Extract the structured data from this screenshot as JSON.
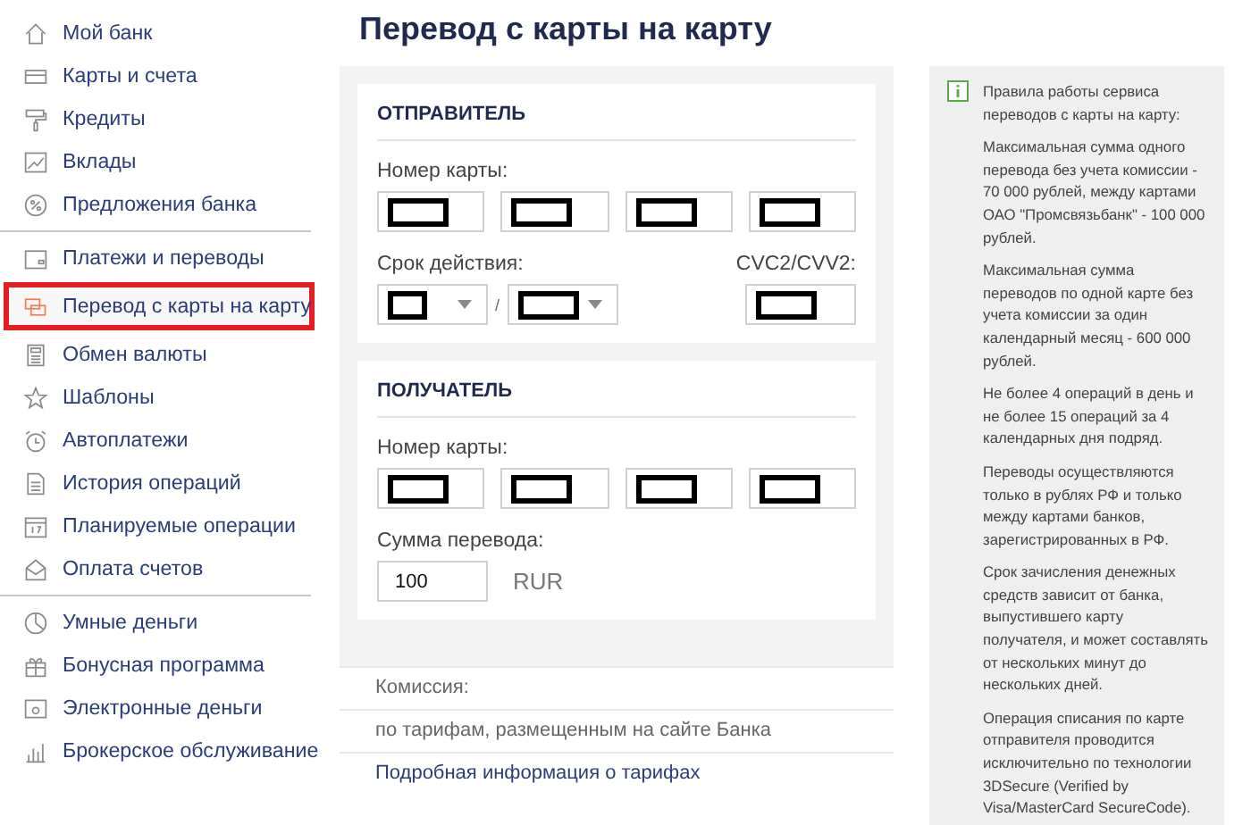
{
  "sidebar": {
    "groups": [
      {
        "items": [
          {
            "label": "Мой банк",
            "selected": false
          },
          {
            "label": "Карты и счета",
            "selected": false
          },
          {
            "label": "Кредиты",
            "selected": false
          },
          {
            "label": "Вклады",
            "selected": false
          },
          {
            "label": "Предложения банка",
            "selected": false
          }
        ]
      },
      {
        "items": [
          {
            "label": "Платежи и переводы",
            "selected": false
          },
          {
            "label": "Перевод с карты на карту",
            "selected": true
          },
          {
            "label": "Обмен валюты",
            "selected": false
          },
          {
            "label": "Шаблоны",
            "selected": false
          },
          {
            "label": "Автоплатежи",
            "selected": false
          },
          {
            "label": "История операций",
            "selected": false
          },
          {
            "label": "Планируемые операции",
            "selected": false
          },
          {
            "label": "Оплата счетов",
            "selected": false
          }
        ]
      },
      {
        "items": [
          {
            "label": "Умные деньги",
            "selected": false
          },
          {
            "label": "Бонусная программа",
            "selected": false
          },
          {
            "label": "Электронные деньги",
            "selected": false
          },
          {
            "label": "Брокерское обслуживание",
            "selected": false
          }
        ]
      }
    ]
  },
  "page_title": "Перевод с карты на карту",
  "sender": {
    "title": "ОТПРАВИТЕЛЬ",
    "card_label": "Номер карты:",
    "card_fields": [
      {
        "redacted": true
      },
      {
        "redacted": true
      },
      {
        "redacted": true
      },
      {
        "redacted": true
      }
    ],
    "expiry": {
      "label": "Срок действия:",
      "month": {
        "redacted": true
      },
      "separator": "/",
      "year": {
        "redacted": true
      }
    },
    "cvc": {
      "label": "CVC2/CVV2:",
      "redacted": true
    }
  },
  "recipient": {
    "title": "ПОЛУЧАТЕЛЬ",
    "card_label": "Номер карты:",
    "card_fields": [
      {
        "redacted": true
      },
      {
        "redacted": true
      },
      {
        "redacted": true
      },
      {
        "redacted": true
      }
    ],
    "amount": {
      "label": "Сумма перевода:",
      "value": "100",
      "currency": "RUR"
    }
  },
  "commission": {
    "label": "Комиссия:",
    "text": "по тарифам, размещенным на сайте Банка",
    "link": "Подробная информация о тарифах"
  },
  "info": {
    "title": "Правила работы сервиса переводов с карты на карту:",
    "bullets": [
      "Максимальная сумма одного перевода без учета комиссии - 70 000 рублей, между картами ОАО \"Промсвязьбанк\" - 100 000 рублей.",
      "Максимальная сумма переводов по одной карте без учета комиссии за один календарный месяц - 600 000 рублей.",
      "Не более 4 операций в день и не более 15 операций за 4 календарных дня подряд.",
      "Переводы осуществляются только в рублях РФ и только между картами банков, зарегистрированных в РФ.",
      "Срок зачисления денежных средств зависит от банка, выпустившего карту получателя, и может составлять от нескольких минут до нескольких дней.",
      "Операция списания по карте отправителя проводится исключительно по технологии 3DSecure (Verified by Visa/MasterCard SecureCode)."
    ]
  }
}
